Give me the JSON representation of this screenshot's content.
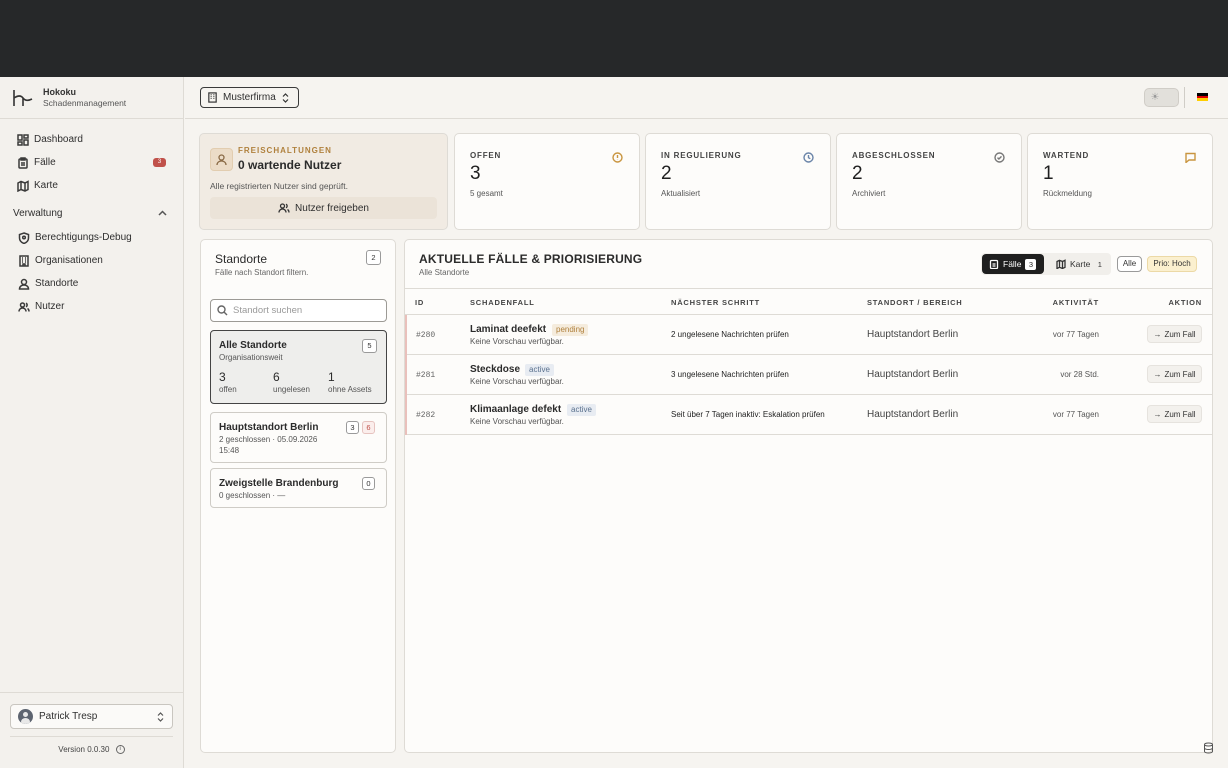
{
  "brand": {
    "name": "Hokoku",
    "subtitle": "Schadenmanagement"
  },
  "sidebar": {
    "items": [
      {
        "label": "Dashboard",
        "icon": "dashboard-icon"
      },
      {
        "label": "Fälle",
        "icon": "clipboard-icon",
        "badge": "3"
      },
      {
        "label": "Karte",
        "icon": "map-icon"
      }
    ],
    "group": {
      "label": "Verwaltung",
      "items": [
        {
          "label": "Berechtigungs-Debug",
          "icon": "shield-icon"
        },
        {
          "label": "Organisationen",
          "icon": "building-icon"
        },
        {
          "label": "Standorte",
          "icon": "location-user-icon"
        },
        {
          "label": "Nutzer",
          "icon": "users-icon"
        }
      ]
    },
    "user": "Patrick Tresp",
    "version": "Version 0.0.30"
  },
  "header": {
    "company": "Musterfirma",
    "language_flag": "de"
  },
  "release_card": {
    "label": "FREISCHALTUNGEN",
    "title": "0 wartende Nutzer",
    "description": "Alle registrierten Nutzer sind geprüft.",
    "button": "Nutzer freigeben"
  },
  "stats": [
    {
      "label": "OFFEN",
      "value": "3",
      "sub": "5 gesamt",
      "icon": "alert-circle-icon",
      "color": "#c9953f"
    },
    {
      "label": "IN REGULIERUNG",
      "value": "2",
      "sub": "Aktualisiert",
      "icon": "clock-icon",
      "color": "#6a84a8"
    },
    {
      "label": "ABGESCHLOSSEN",
      "value": "2",
      "sub": "Archiviert",
      "icon": "check-circle-icon",
      "color": "#777777"
    },
    {
      "label": "WARTEND",
      "value": "1",
      "sub": "Rückmeldung",
      "icon": "message-icon",
      "color": "#c9953f"
    }
  ],
  "locations": {
    "title": "Standorte",
    "subtitle": "Fälle nach Standort filtern.",
    "count": "2",
    "search_placeholder": "Standort suchen",
    "all": {
      "name": "Alle Standorte",
      "meta": "Organisationsweit",
      "count": "5",
      "stats": [
        {
          "value": "3",
          "label": "offen"
        },
        {
          "value": "6",
          "label": "ungelesen"
        },
        {
          "value": "1",
          "label": "ohne Assets"
        }
      ]
    },
    "berlin": {
      "name": "Hauptstandort Berlin",
      "meta1": "2 geschlossen · 05.09.2026",
      "meta2": "15:48",
      "count_a": "3",
      "count_b": "6"
    },
    "brandenburg": {
      "name": "Zweigstelle Brandenburg",
      "meta": "0 geschlossen · —",
      "count": "0"
    }
  },
  "cases": {
    "title": "AKTUELLE FÄLLE & PRIORISIERUNG",
    "subtitle": "Alle Standorte",
    "seg_cases": {
      "label": "Fälle",
      "count": "3"
    },
    "seg_map": {
      "label": "Karte",
      "count": "1"
    },
    "chip_all": "Alle",
    "chip_prio": "Prio: Hoch",
    "columns": [
      "ID",
      "SCHADENFALL",
      "NÄCHSTER SCHRITT",
      "STANDORT / BEREICH",
      "AKTIVITÄT",
      "AKTION"
    ],
    "rows": [
      {
        "id": "#280",
        "name": "Laminat deefekt",
        "status": "pending",
        "preview": "Keine Vorschau verfügbar.",
        "next": "2 ungelesene Nachrichten prüfen",
        "location": "Hauptstandort Berlin",
        "activity": "vor 77 Tagen",
        "action": "Zum Fall"
      },
      {
        "id": "#281",
        "name": "Steckdose",
        "status": "active",
        "preview": "Keine Vorschau verfügbar.",
        "next": "3 ungelesene Nachrichten prüfen",
        "location": "Hauptstandort Berlin",
        "activity": "vor 28 Std.",
        "action": "Zum Fall"
      },
      {
        "id": "#282",
        "name": "Klimaanlage defekt",
        "status": "active",
        "preview": "Keine Vorschau verfügbar.",
        "next": "Seit über 7 Tagen inaktiv: Eskalation prüfen",
        "location": "Hauptstandort Berlin",
        "activity": "vor 77 Tagen",
        "action": "Zum Fall"
      }
    ]
  }
}
